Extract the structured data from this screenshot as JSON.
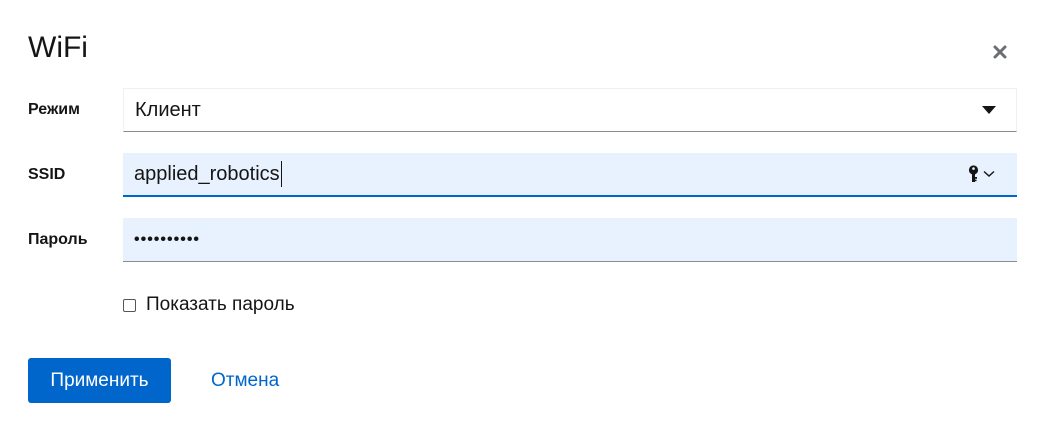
{
  "dialog": {
    "title": "WiFi"
  },
  "form": {
    "mode": {
      "label": "Режим",
      "selected": "Клиент"
    },
    "ssid": {
      "label": "SSID",
      "value": "applied_robotics"
    },
    "password": {
      "label": "Пароль",
      "masked_value": "••••••••••",
      "show_password_label": "Показать пароль",
      "show_password_checked": false
    }
  },
  "actions": {
    "apply_label": "Применить",
    "cancel_label": "Отмена"
  },
  "colors": {
    "primary": "#0066cc",
    "field_bg": "#e8f2fe",
    "text": "#151515"
  },
  "icons": {
    "close": "close-icon",
    "select_caret": "caret-down-icon",
    "key": "key-icon",
    "chevron": "chevron-down-icon"
  }
}
